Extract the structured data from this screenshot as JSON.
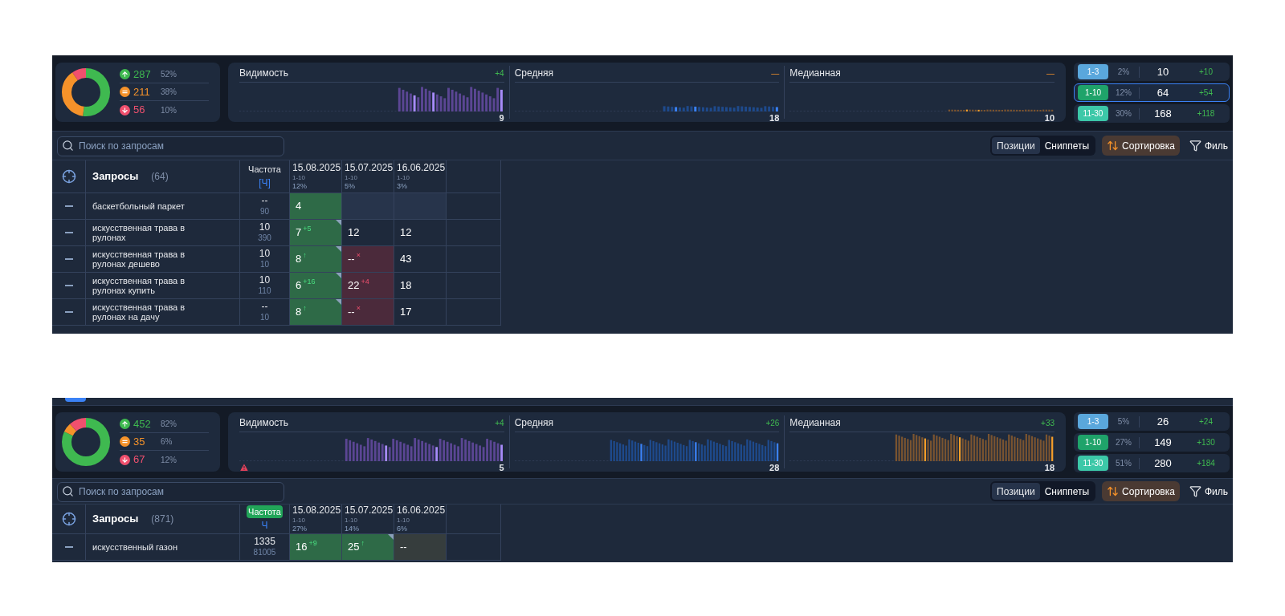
{
  "panels": [
    {
      "tab_strip": false,
      "summary": {
        "stats": [
          {
            "kind": "up",
            "value": "287",
            "pct": "52%"
          },
          {
            "kind": "same",
            "value": "211",
            "pct": "38%"
          },
          {
            "kind": "down",
            "value": "56",
            "pct": "10%"
          }
        ]
      },
      "charts": [
        {
          "kind": "visibility",
          "title": "Видимость",
          "delta": {
            "text": "+4",
            "kind": "up"
          },
          "value": "9",
          "warning": false
        },
        {
          "kind": "average",
          "title": "Средняя",
          "delta": {
            "text": "—",
            "kind": "flat"
          },
          "value": "18",
          "warning": false
        },
        {
          "kind": "median",
          "title": "Медианная",
          "delta": {
            "text": "—",
            "kind": "flat"
          },
          "value": "10",
          "warning": false
        }
      ],
      "ranges": [
        {
          "label": "1-3",
          "color": "#5aa7dc",
          "pct": "2%",
          "count": "10",
          "delta": "+10",
          "selected": false
        },
        {
          "label": "1-10",
          "color": "#1fa36a",
          "pct": "12%",
          "count": "64",
          "delta": "+54",
          "selected": true
        },
        {
          "label": "11-30",
          "color": "#3cc8a8",
          "pct": "30%",
          "count": "168",
          "delta": "+118",
          "selected": false
        }
      ],
      "search": {
        "placeholder": "Поиск по запросам"
      },
      "view_toggle": [
        {
          "label": "Позиции",
          "selected": true
        },
        {
          "label": "Сниппеты",
          "selected": false
        }
      ],
      "sort_button": "Сортировка",
      "filter_button": "Филь",
      "table": {
        "title": "Запросы",
        "count": "(64)",
        "freq": {
          "label": "Частота",
          "unit": "[Ч]",
          "highlighted": false
        },
        "dates": [
          {
            "date": "15.08.2025",
            "range": "1-10",
            "pct": "12%"
          },
          {
            "date": "15.07.2025",
            "range": "1-10",
            "pct": "5%"
          },
          {
            "date": "16.06.2025",
            "range": "1-10",
            "pct": "3%"
          }
        ],
        "rows": [
          {
            "query": "баскетбольный паркет",
            "freq": "--",
            "freq_sub": "90",
            "cells": [
              {
                "value": "4",
                "kind": "good",
                "flag": false
              },
              {
                "kind": "empty",
                "flag": false
              },
              {
                "kind": "empty",
                "flag": false
              }
            ]
          },
          {
            "query": "искусственная трава в рулонах",
            "freq": "10",
            "freq_sub": "390",
            "cells": [
              {
                "value": "7",
                "delta": "+5",
                "kind": "good",
                "flag": true
              },
              {
                "value": "12",
                "kind": "plain",
                "flag": false
              },
              {
                "value": "12",
                "kind": "plain",
                "flag": false
              }
            ]
          },
          {
            "query": "искусственная трава в рулонах дешево",
            "freq": "10",
            "freq_sub": "10",
            "cells": [
              {
                "value": "8",
                "delta": "↑",
                "kind": "good",
                "flag": true
              },
              {
                "value": "--",
                "delta": "×",
                "kind": "bad",
                "flag": false
              },
              {
                "value": "43",
                "kind": "plain",
                "flag": false
              }
            ]
          },
          {
            "query": "искусственная трава в рулонах купить",
            "freq": "10",
            "freq_sub": "110",
            "cells": [
              {
                "value": "6",
                "delta": "+16",
                "kind": "good",
                "flag": true
              },
              {
                "value": "22",
                "delta": "+4",
                "kind": "bad",
                "flag": false
              },
              {
                "value": "18",
                "kind": "plain",
                "flag": false
              }
            ]
          },
          {
            "query": "искусственная трава в рулонах на дачу",
            "freq": "--",
            "freq_sub": "10",
            "cells": [
              {
                "value": "8",
                "delta": "↑",
                "kind": "good",
                "flag": true
              },
              {
                "value": "--",
                "delta": "×",
                "kind": "bad",
                "flag": false
              },
              {
                "value": "17",
                "kind": "plain",
                "flag": false
              }
            ]
          }
        ]
      }
    },
    {
      "tab_strip": true,
      "summary": {
        "stats": [
          {
            "kind": "up",
            "value": "452",
            "pct": "82%"
          },
          {
            "kind": "same",
            "value": "35",
            "pct": "6%"
          },
          {
            "kind": "down",
            "value": "67",
            "pct": "12%"
          }
        ]
      },
      "charts": [
        {
          "kind": "visibility",
          "title": "Видимость",
          "delta": {
            "text": "+4",
            "kind": "up"
          },
          "value": "5",
          "warning": true
        },
        {
          "kind": "average",
          "title": "Средняя",
          "delta": {
            "text": "+26",
            "kind": "up"
          },
          "value": "28",
          "warning": false
        },
        {
          "kind": "median",
          "title": "Медианная",
          "delta": {
            "text": "+33",
            "kind": "up"
          },
          "value": "18",
          "warning": false
        }
      ],
      "ranges": [
        {
          "label": "1-3",
          "color": "#5aa7dc",
          "pct": "5%",
          "count": "26",
          "delta": "+24",
          "selected": false
        },
        {
          "label": "1-10",
          "color": "#1fa36a",
          "pct": "27%",
          "count": "149",
          "delta": "+130",
          "selected": false
        },
        {
          "label": "11-30",
          "color": "#3cc8a8",
          "pct": "51%",
          "count": "280",
          "delta": "+184",
          "selected": false
        }
      ],
      "search": {
        "placeholder": "Поиск по запросам"
      },
      "view_toggle": [
        {
          "label": "Позиции",
          "selected": true
        },
        {
          "label": "Сниппеты",
          "selected": false
        }
      ],
      "sort_button": "Сортировка",
      "filter_button": "Филь",
      "table": {
        "title": "Запросы",
        "count": "(871)",
        "freq": {
          "label": "Частота",
          "unit": "Ч",
          "highlighted": true
        },
        "dates": [
          {
            "date": "15.08.2025",
            "range": "1-10",
            "pct": "27%"
          },
          {
            "date": "15.07.2025",
            "range": "1-10",
            "pct": "14%"
          },
          {
            "date": "16.06.2025",
            "range": "1-10",
            "pct": "6%"
          }
        ],
        "rows": [
          {
            "query": "искусственный газон",
            "freq": "1335",
            "freq_sub": "81005",
            "cells": [
              {
                "value": "16",
                "delta": "+9",
                "kind": "good",
                "flag": false
              },
              {
                "value": "25",
                "delta": "↑",
                "kind": "good",
                "flag": true
              },
              {
                "value": "--",
                "kind": "neutral",
                "flag": false
              }
            ]
          }
        ]
      }
    }
  ]
}
